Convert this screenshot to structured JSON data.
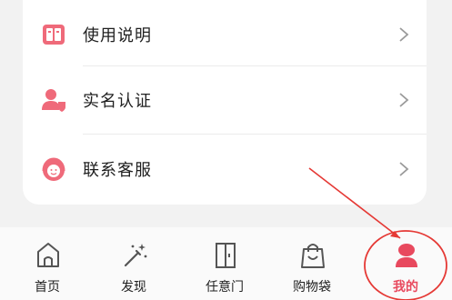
{
  "menu": {
    "items": [
      {
        "label": "使用说明",
        "icon": "book-icon"
      },
      {
        "label": "实名认证",
        "icon": "user-verify-icon"
      },
      {
        "label": "联系客服",
        "icon": "customer-service-icon"
      }
    ]
  },
  "tabbar": {
    "tabs": [
      {
        "label": "首页",
        "icon": "home-icon",
        "active": false
      },
      {
        "label": "发现",
        "icon": "magic-wand-icon",
        "active": false
      },
      {
        "label": "任意门",
        "icon": "door-icon",
        "active": false
      },
      {
        "label": "购物袋",
        "icon": "shopping-bag-icon",
        "active": false
      },
      {
        "label": "我的",
        "icon": "profile-icon",
        "active": true
      }
    ]
  },
  "colors": {
    "accent": "#e8495e",
    "annotation": "#e53935"
  }
}
